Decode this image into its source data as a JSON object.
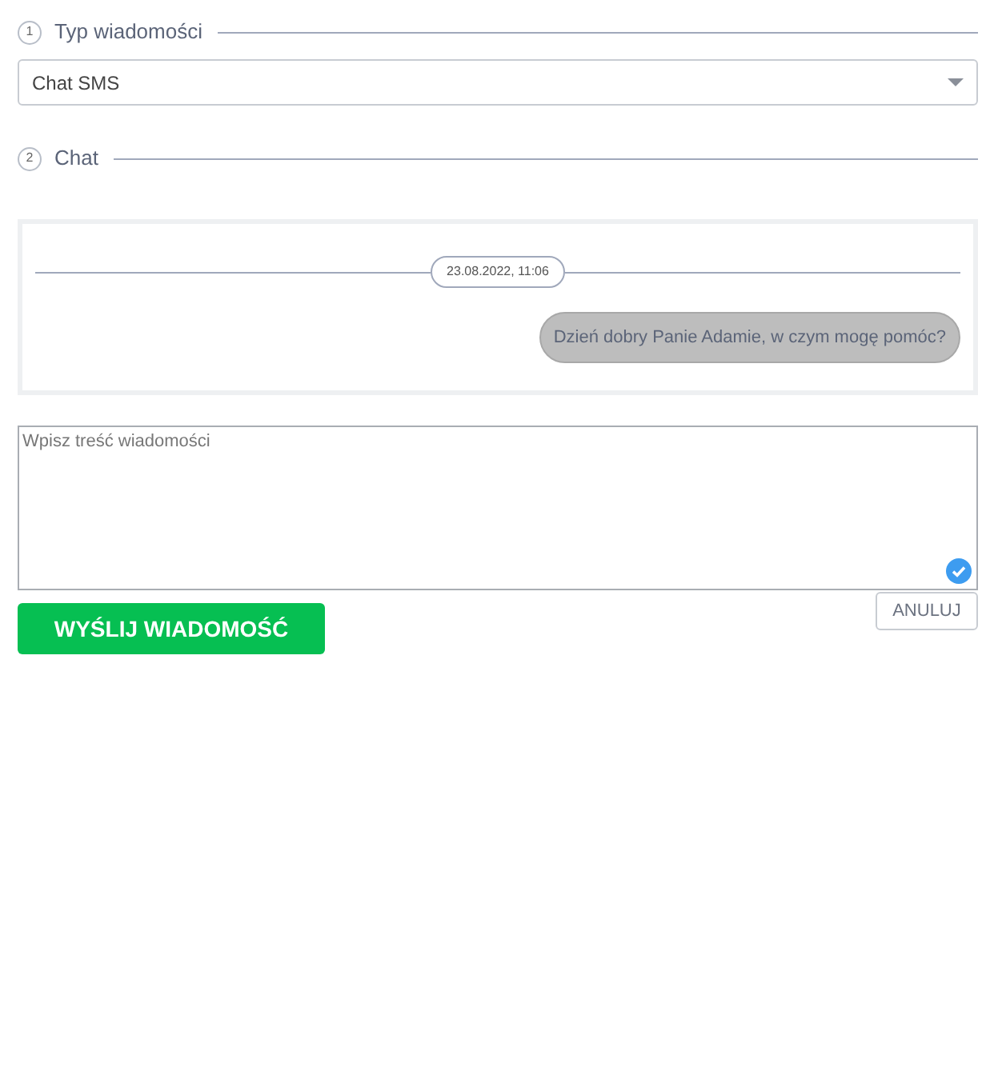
{
  "steps": [
    {
      "number": "1",
      "title": "Typ wiadomości"
    },
    {
      "number": "2",
      "title": "Chat"
    }
  ],
  "message_type": {
    "value": "Chat SMS"
  },
  "chat": {
    "date": "23.08.2022, 11:06",
    "messages": [
      {
        "text": "Dzień dobry Panie Adamie, w czym mogę pomóc?",
        "outgoing": true
      }
    ]
  },
  "composer": {
    "placeholder": "Wpisz treść wiadomości",
    "valid": true
  },
  "buttons": {
    "send": "WYŚLIJ WIADOMOŚĆ",
    "cancel": "ANULUJ"
  }
}
